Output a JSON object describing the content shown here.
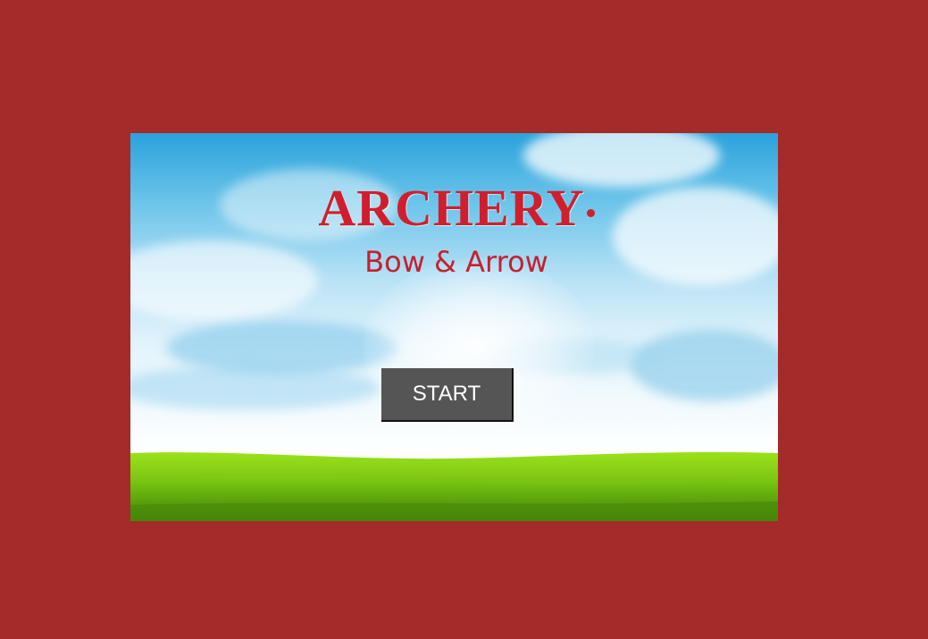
{
  "game": {
    "title": "ARCHERY",
    "subtitle": "Bow & Arrow",
    "start_label": "START"
  },
  "colors": {
    "page_background": "#a52a2a",
    "title_red": "#cf1f2e",
    "button_background": "#555555",
    "button_text": "#ffffff",
    "grass": "#6cc417"
  }
}
